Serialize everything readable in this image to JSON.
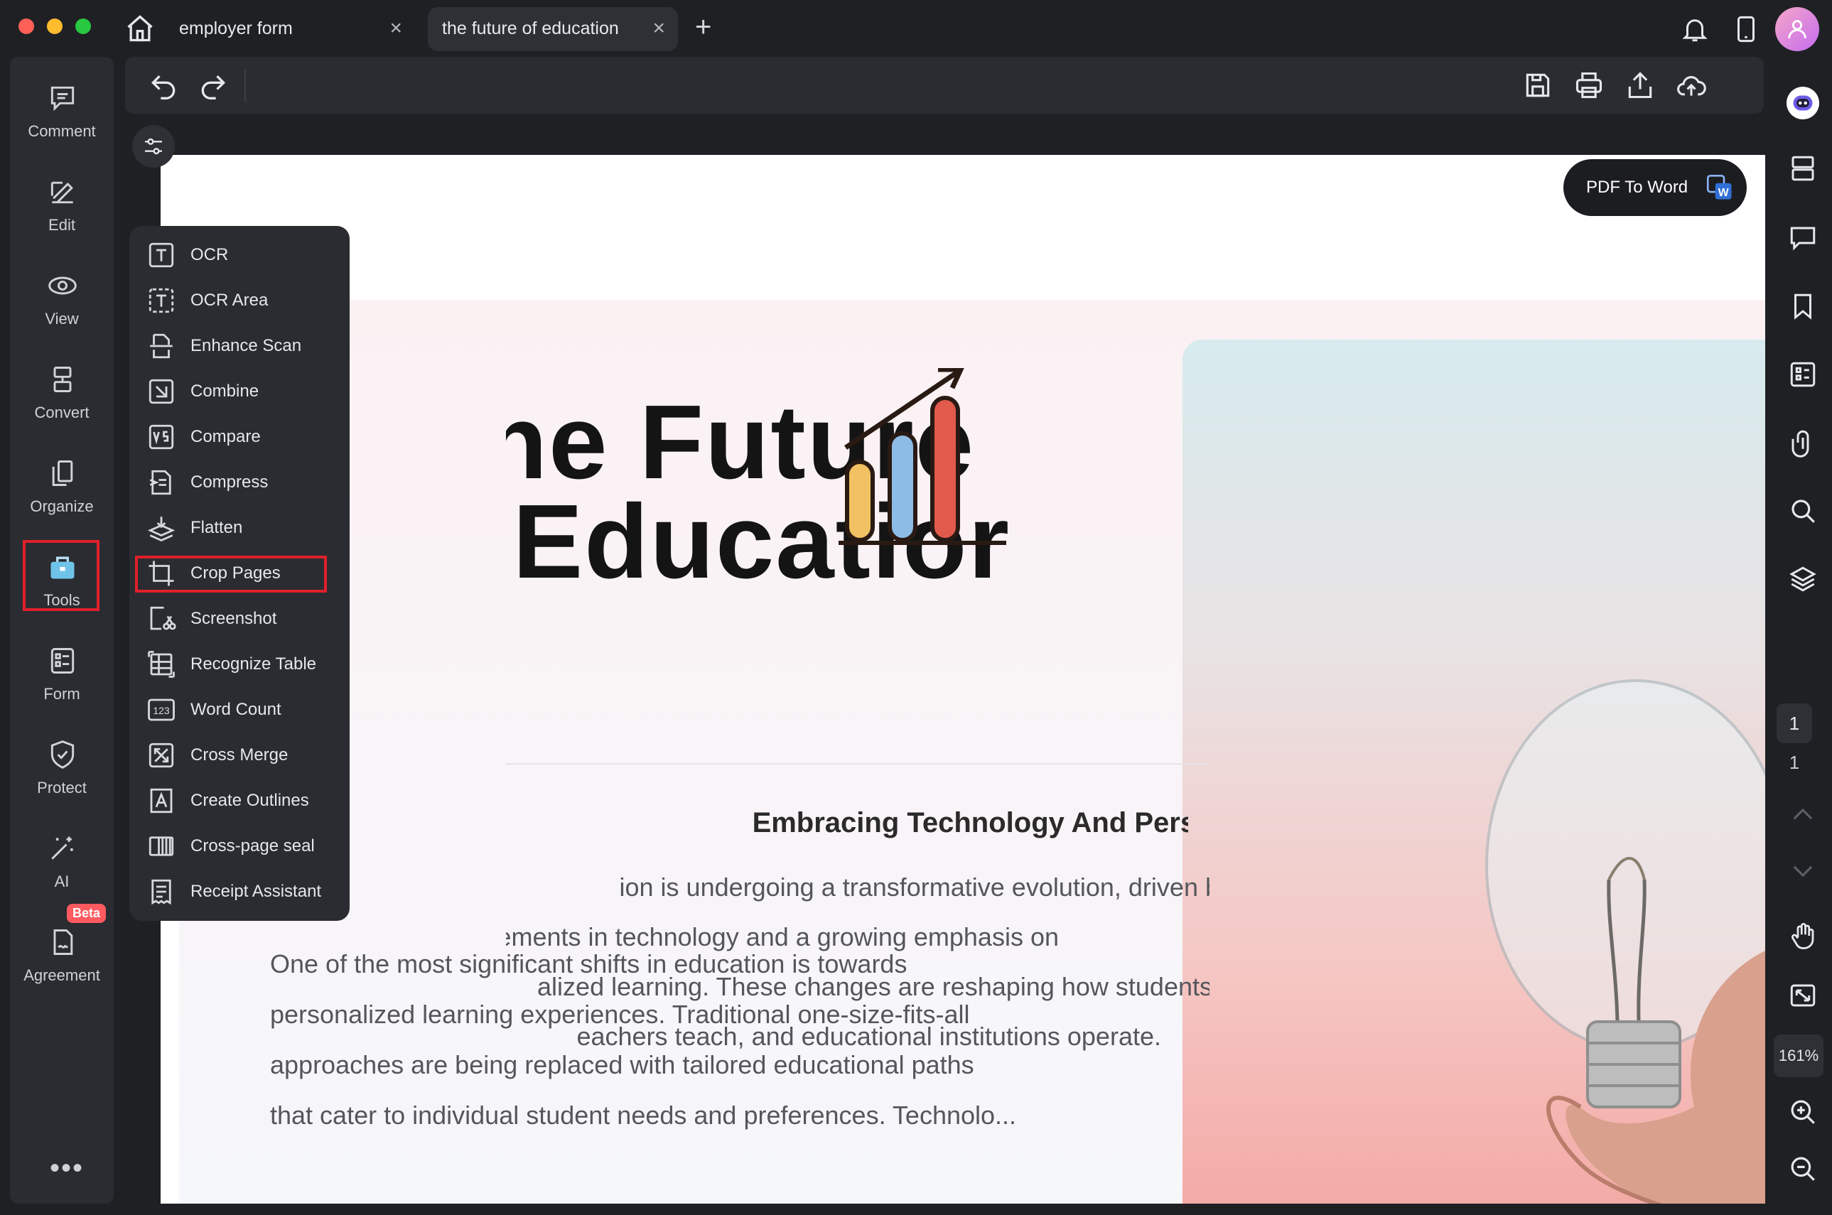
{
  "tabs": [
    {
      "label": "employer form",
      "close": "×"
    },
    {
      "label": "the future of education",
      "close": "×"
    }
  ],
  "new_tab": "+",
  "left_sidebar": {
    "items": [
      {
        "label": "Comment",
        "icon": "comment-icon"
      },
      {
        "label": "Edit",
        "icon": "edit-icon"
      },
      {
        "label": "View",
        "icon": "eye-icon"
      },
      {
        "label": "Convert",
        "icon": "convert-icon"
      },
      {
        "label": "Organize",
        "icon": "organize-icon"
      },
      {
        "label": "Tools",
        "icon": "toolbox-icon"
      },
      {
        "label": "Form",
        "icon": "form-icon"
      },
      {
        "label": "Protect",
        "icon": "shield-icon"
      },
      {
        "label": "AI",
        "icon": "magic-wand-icon"
      },
      {
        "label": "Agreement",
        "icon": "agreement-icon"
      }
    ],
    "beta_badge": "Beta",
    "more": "•••"
  },
  "tools_menu": {
    "items": [
      {
        "label": "OCR",
        "icon": "ocr-icon"
      },
      {
        "label": "OCR Area",
        "icon": "ocr-area-icon"
      },
      {
        "label": "Enhance Scan",
        "icon": "enhance-scan-icon"
      },
      {
        "label": "Combine",
        "icon": "combine-icon"
      },
      {
        "label": "Compare",
        "icon": "compare-icon"
      },
      {
        "label": "Compress",
        "icon": "compress-icon"
      },
      {
        "label": "Flatten",
        "icon": "flatten-icon"
      },
      {
        "label": "Crop Pages",
        "icon": "crop-icon"
      },
      {
        "label": "Screenshot",
        "icon": "screenshot-icon"
      },
      {
        "label": "Recognize Table",
        "icon": "table-icon"
      },
      {
        "label": "Word Count",
        "icon": "word-count-icon"
      },
      {
        "label": "Cross Merge",
        "icon": "cross-merge-icon"
      },
      {
        "label": "Create Outlines",
        "icon": "outlines-icon"
      },
      {
        "label": "Cross-page seal",
        "icon": "seal-icon"
      },
      {
        "label": "Receipt Assistant",
        "icon": "receipt-icon"
      }
    ],
    "highlighted": "Crop Pages"
  },
  "document": {
    "title_line1": "he Future",
    "title_line2": "f Educatior",
    "subheading": "Embracing Technology And Personalization",
    "para1": [
      "ion is undergoing a transformative evolution, driven by",
      "cements in technology and a growing emphasis on",
      "alized learning. These changes are reshaping how students",
      "eachers teach, and educational institutions operate."
    ],
    "para2": [
      "One of the most significant shifts in education is towards",
      "personalized learning experiences. Traditional one-size-fits-all",
      "approaches are being replaced with tailored educational paths",
      "that cater to individual student needs and preferences. Technolo..."
    ]
  },
  "pdf_to_word": "PDF To Word",
  "page_nav": {
    "current": "1",
    "total": "1"
  },
  "zoom": "161%",
  "colors": {
    "highlight": "#e0202a",
    "beta": "#ff5a5f",
    "accent_word": "#2f6fd6"
  }
}
